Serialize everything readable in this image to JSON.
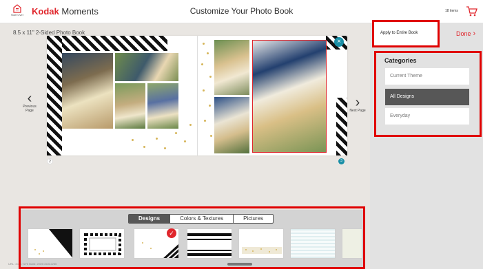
{
  "header": {
    "start_over_label": "Start Over",
    "brand_kodak": "Kodak",
    "brand_moments": "Moments",
    "title": "Customize Your Photo Book",
    "items_count": "18 items"
  },
  "workspace": {
    "product_title": "8.5 x 11\" 2-Sided Photo Book",
    "prev_label": "Previous Page",
    "next_label": "Next Page",
    "left_page_number": "2",
    "right_page_number": "3",
    "close_symbol": "×"
  },
  "design_panel": {
    "tabs": [
      "Designs",
      "Colors & Textures",
      "Pictures"
    ],
    "active_tab": "Designs",
    "build_info": "URL: 3.0.0.7275 Build: 2019.0315.2255"
  },
  "sidebar": {
    "apply_label": "Apply to Entire Book",
    "done_label": "Done",
    "categories_title": "Categories",
    "categories": [
      "Current Theme",
      "All Designs",
      "Everyday"
    ],
    "active_category": "All Designs"
  },
  "colors": {
    "brand_red": "#e0262c",
    "accent_teal": "#1a8fa6",
    "highlight_red": "#e00000",
    "dark_gray": "#575757"
  }
}
